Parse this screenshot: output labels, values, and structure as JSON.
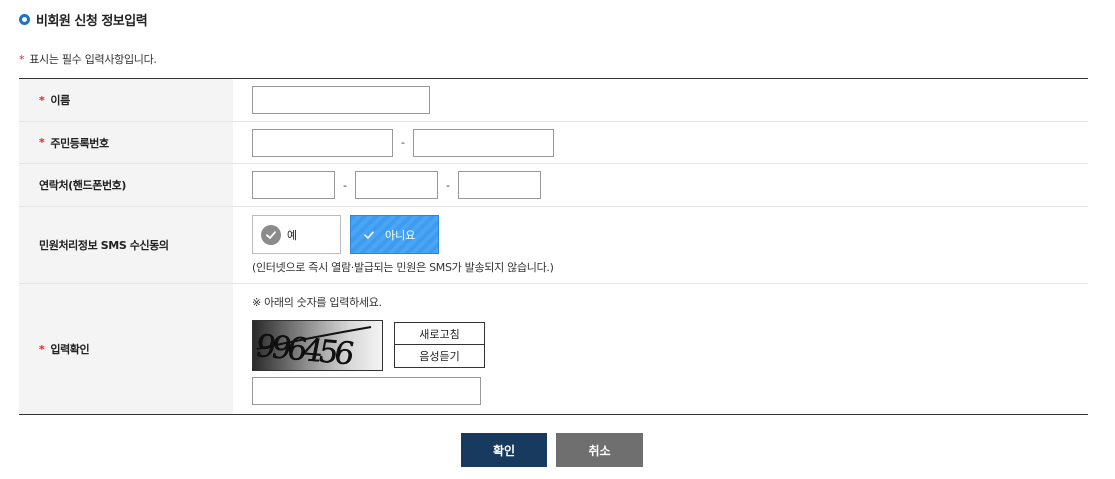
{
  "section": {
    "title": "비회원 신청 정보입력"
  },
  "required_note": {
    "star": "*",
    "text": "표시는 필수 입력사항입니다."
  },
  "form": {
    "name": {
      "star": "*",
      "label": "이름",
      "value": ""
    },
    "rrn": {
      "star": "*",
      "label": "주민등록번호",
      "part1": "",
      "part2": "",
      "dash": "-"
    },
    "phone": {
      "label": "연락처(핸드폰번호)",
      "part1": "",
      "part2": "",
      "part3": "",
      "dash": "-"
    },
    "sms": {
      "label": "민원처리정보 SMS 수신동의",
      "options": [
        {
          "label": "예",
          "selected": false
        },
        {
          "label": "아니요",
          "selected": true
        }
      ],
      "note": "(인터넷으로 즉시 열람·발급되는 민원은 SMS가 발송되지 않습니다.)"
    },
    "captcha": {
      "star": "*",
      "label": "입력확인",
      "guide": "※ 아래의 숫자를 입력하세요.",
      "code": "996456",
      "refresh_label": "새로고침",
      "audio_label": "음성듣기",
      "value": ""
    }
  },
  "actions": {
    "confirm_label": "확인",
    "cancel_label": "취소"
  },
  "colors": {
    "accent": "#1a73c9",
    "required": "#e0242e",
    "confirm": "#173a5e",
    "cancel": "#6f6f6f",
    "selected_option": "#3d9cf0"
  }
}
